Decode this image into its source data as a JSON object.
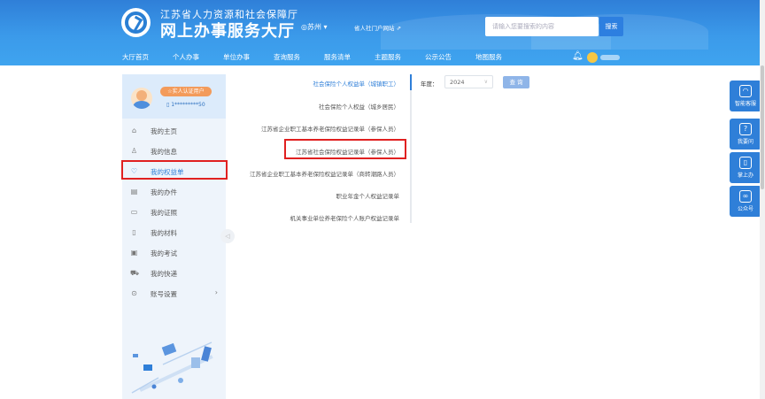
{
  "header": {
    "org_name": "江苏省人力资源和社会保障厅",
    "site_title": "网上办事服务大厅",
    "city": "◎苏州 ▾",
    "portal_link": "省人社门户网站",
    "search_placeholder": "请输入您要搜索的内容",
    "search_button": "搜索"
  },
  "nav": {
    "items": [
      "大厅首页",
      "个人办事",
      "单位办事",
      "查询服务",
      "服务清单",
      "主题服务",
      "公示公告",
      "地图服务"
    ]
  },
  "sidebar": {
    "badge": "☆实人认证用户",
    "phone": "1*********50",
    "items": [
      {
        "label": "我的主页",
        "icon": "home-icon",
        "glyph": "⌂"
      },
      {
        "label": "我的信息",
        "icon": "user-icon",
        "glyph": "♙"
      },
      {
        "label": "我的权益单",
        "icon": "shield-icon",
        "glyph": "♡"
      },
      {
        "label": "我的办件",
        "icon": "file-icon",
        "glyph": "▤"
      },
      {
        "label": "我的证照",
        "icon": "card-icon",
        "glyph": "▭"
      },
      {
        "label": "我的材料",
        "icon": "folder-icon",
        "glyph": "▯"
      },
      {
        "label": "我的考试",
        "icon": "exam-icon",
        "glyph": "▣"
      },
      {
        "label": "我的快递",
        "icon": "truck-icon",
        "glyph": "⛟"
      },
      {
        "label": "账号设置",
        "icon": "settings-icon",
        "glyph": "⊙"
      }
    ],
    "collapse": "◁"
  },
  "records": {
    "items": [
      "社会保险个人权益单（城镇职工）",
      "社会保险个人权益（城乡居民）",
      "江苏省企业职工基本养老保险权益记录单（参保人员）",
      "江苏省社会保险权益记录单（参保人员）",
      "江苏省企业职工基本养老保险权益记录单（商转潮路人员）",
      "职业年金个人权益记录单",
      "机关事业单位养老保险个人账户权益记录单"
    ]
  },
  "filter": {
    "year_label": "年度：",
    "year_value": "2024",
    "query_button": "查 询"
  },
  "float_bar": {
    "items": [
      "智能客服",
      "我要问",
      "掌上办",
      "公众号"
    ]
  },
  "colors": {
    "primary": "#2f7fd8",
    "highlight_box": "#e02020",
    "badge": "#f39b5b"
  }
}
